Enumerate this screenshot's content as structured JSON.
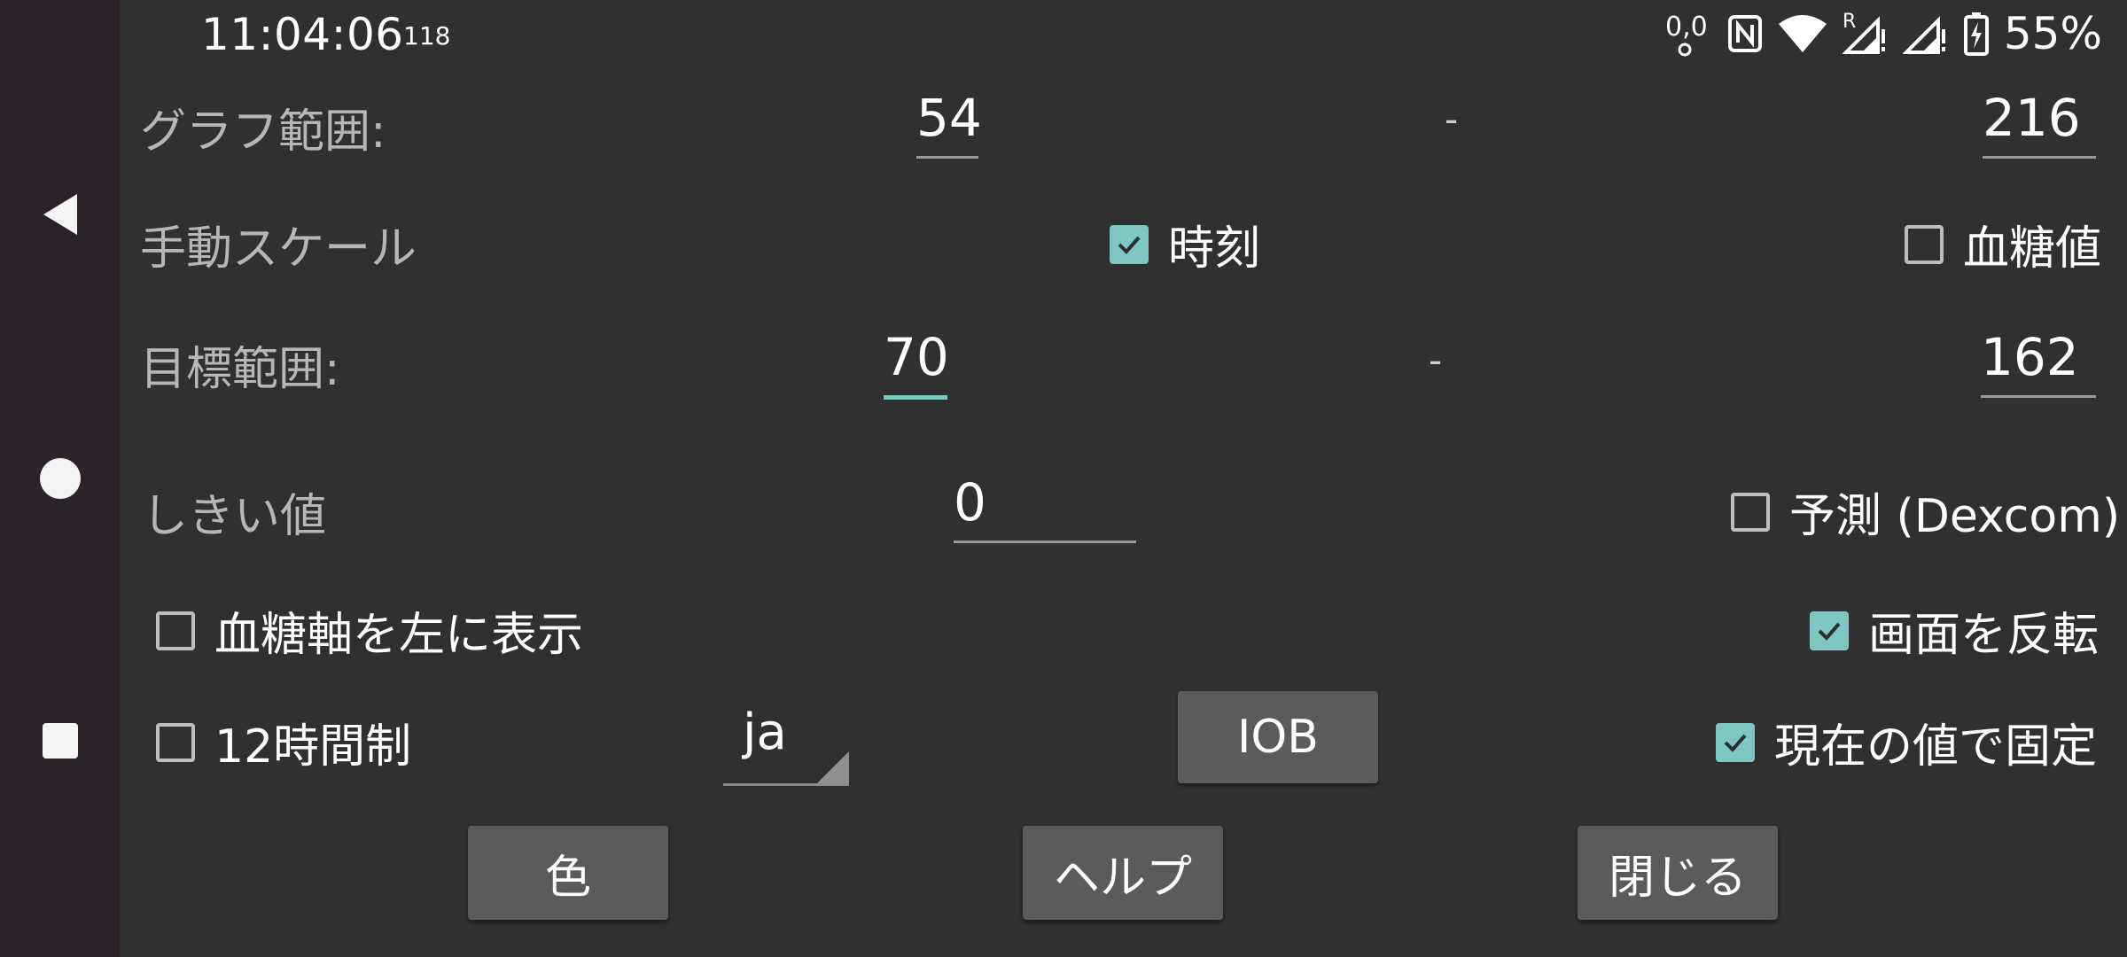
{
  "status": {
    "time": "11:04:06",
    "time_sub": "118",
    "icons": [
      "data-saver-icon",
      "nfc-icon",
      "wifi-icon",
      "signal-roaming-icon",
      "signal-icon",
      "battery-charging-icon"
    ],
    "roaming_label": "R",
    "battery": "55%"
  },
  "nav": {
    "icons": [
      "back-icon",
      "home-icon",
      "recents-icon"
    ]
  },
  "settings": {
    "graph_range_label": "グラフ範囲:",
    "graph_min": "54",
    "graph_max": "216",
    "range_separator": "-",
    "manual_scale_label": "手動スケール",
    "time_checkbox": {
      "label": "時刻",
      "checked": true
    },
    "bg_checkbox": {
      "label": "血糖値",
      "checked": false
    },
    "target_range_label": "目標範囲:",
    "target_min": "70",
    "target_max": "162",
    "threshold_label": "しきい値",
    "threshold_value": "0",
    "predict_checkbox": {
      "label": "予測 (Dexcom)",
      "checked": false
    },
    "left_axis_checkbox": {
      "label": "血糖軸を左に表示",
      "checked": false
    },
    "invert_checkbox": {
      "label": "画面を反転",
      "checked": true
    },
    "clock12_checkbox": {
      "label": "12時間制",
      "checked": false
    },
    "language_value": "ja",
    "iob_button": "IOB",
    "fix_current_checkbox": {
      "label": "現在の値で固定",
      "checked": true
    }
  },
  "buttons": {
    "color": "色",
    "help": "ヘルプ",
    "close": "閉じる"
  },
  "colors": {
    "accent": "#7dc7c0",
    "background": "#303030",
    "button": "#5b5b5b",
    "navbar": "#2b2329"
  }
}
